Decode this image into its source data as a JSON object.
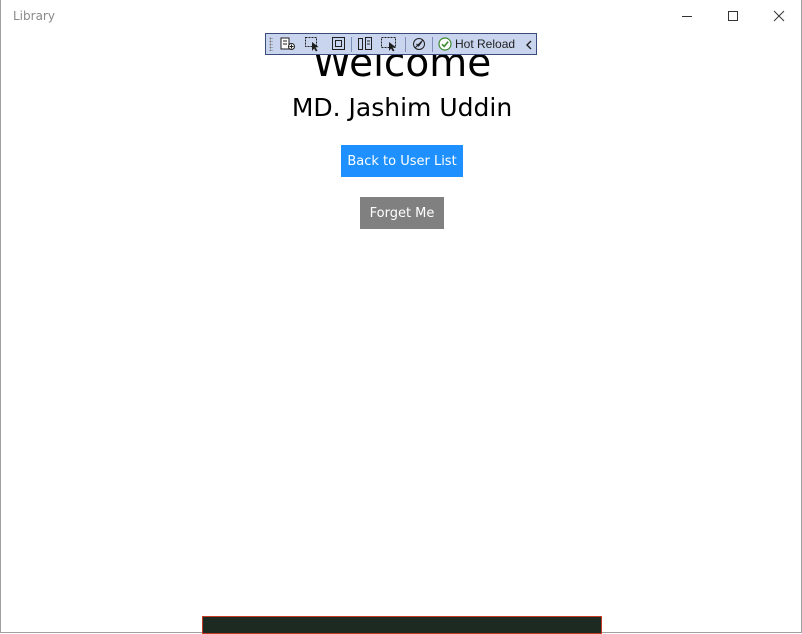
{
  "window": {
    "title": "Library"
  },
  "toolbar": {
    "hot_reload_label": "Hot Reload",
    "icons": [
      "live-visual-tree-icon",
      "select-element-icon",
      "display-layout-adorners-icon",
      "track-focus-icon",
      "binding-failures-icon",
      "preview-icon",
      "hot-reload-check-icon",
      "collapse-chevron-icon"
    ]
  },
  "page": {
    "heading": "Welcome",
    "user_name": "MD. Jashim Uddin"
  },
  "buttons": {
    "back_label": "Back to User List",
    "forget_label": "Forget Me"
  },
  "colors": {
    "primary_button": "#1e90ff",
    "secondary_button": "#808080",
    "toolbar_background": "#c9d5ef"
  }
}
